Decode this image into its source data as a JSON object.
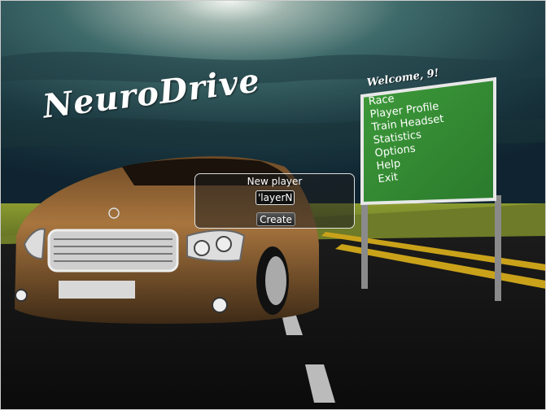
{
  "app": {
    "logo_text": "NeuroDrive"
  },
  "sign": {
    "welcome": "Welcome, 9!",
    "menu_items": [
      "Race",
      "Player Profile",
      "Train Headset",
      "Statistics",
      "Options",
      "Help",
      "Exit"
    ],
    "background_color": "#2e8b33"
  },
  "dialog": {
    "title": "New player",
    "input_value": "PlayerName",
    "input_visible_text": "'layerN",
    "create_label": "Create"
  }
}
